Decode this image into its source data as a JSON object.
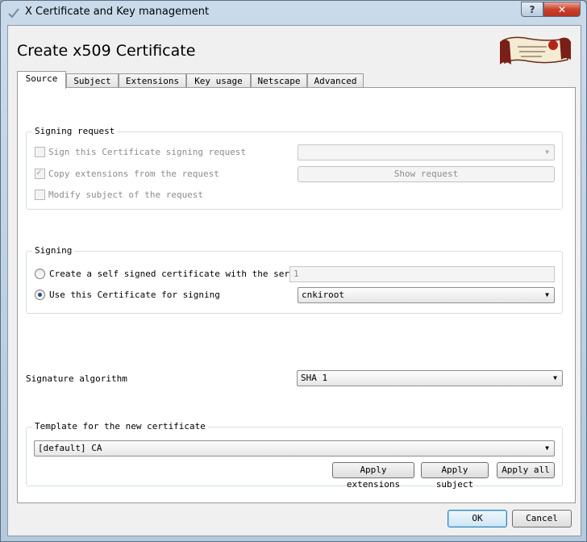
{
  "window": {
    "title": "X Certificate and Key management",
    "help_glyph": "?",
    "close_glyph": "✕"
  },
  "header": {
    "title": "Create x509 Certificate"
  },
  "tabs": [
    {
      "label": "Source",
      "active": true
    },
    {
      "label": "Subject",
      "active": false
    },
    {
      "label": "Extensions",
      "active": false
    },
    {
      "label": "Key usage",
      "active": false
    },
    {
      "label": "Netscape",
      "active": false
    },
    {
      "label": "Advanced",
      "active": false
    }
  ],
  "signing_request": {
    "group_title": "Signing request",
    "sign_csr_label": "Sign this Certificate signing request",
    "sign_csr_checked": false,
    "csr_select_value": "",
    "copy_ext_label": "Copy extensions from the request",
    "copy_ext_checked": true,
    "show_request_label": "Show request",
    "modify_subject_label": "Modify subject of the request",
    "modify_subject_checked": false
  },
  "signing": {
    "group_title": "Signing",
    "self_signed_label": "Create a self signed certificate with the serial",
    "serial_value": "1",
    "use_cert_label": "Use this Certificate for signing",
    "selected_mode": "use_cert",
    "signing_cert_value": "cnkiroot"
  },
  "algorithm": {
    "label": "Signature algorithm",
    "value": "SHA 1"
  },
  "template": {
    "group_title": "Template for the new certificate",
    "value": "[default] CA",
    "apply_extensions_label": "Apply extensions",
    "apply_subject_label": "Apply subject",
    "apply_all_label": "Apply all"
  },
  "footer": {
    "ok_label": "OK",
    "cancel_label": "Cancel"
  },
  "icons": {
    "app_icon": "certificate-check-icon",
    "logo": "xca-scroll-logo",
    "dropdown": "chevron-down-icon"
  },
  "colors": {
    "close_button": "#c9432c",
    "selected_radio": "#1f4f8a",
    "default_button_border": "#3c7fb1"
  }
}
